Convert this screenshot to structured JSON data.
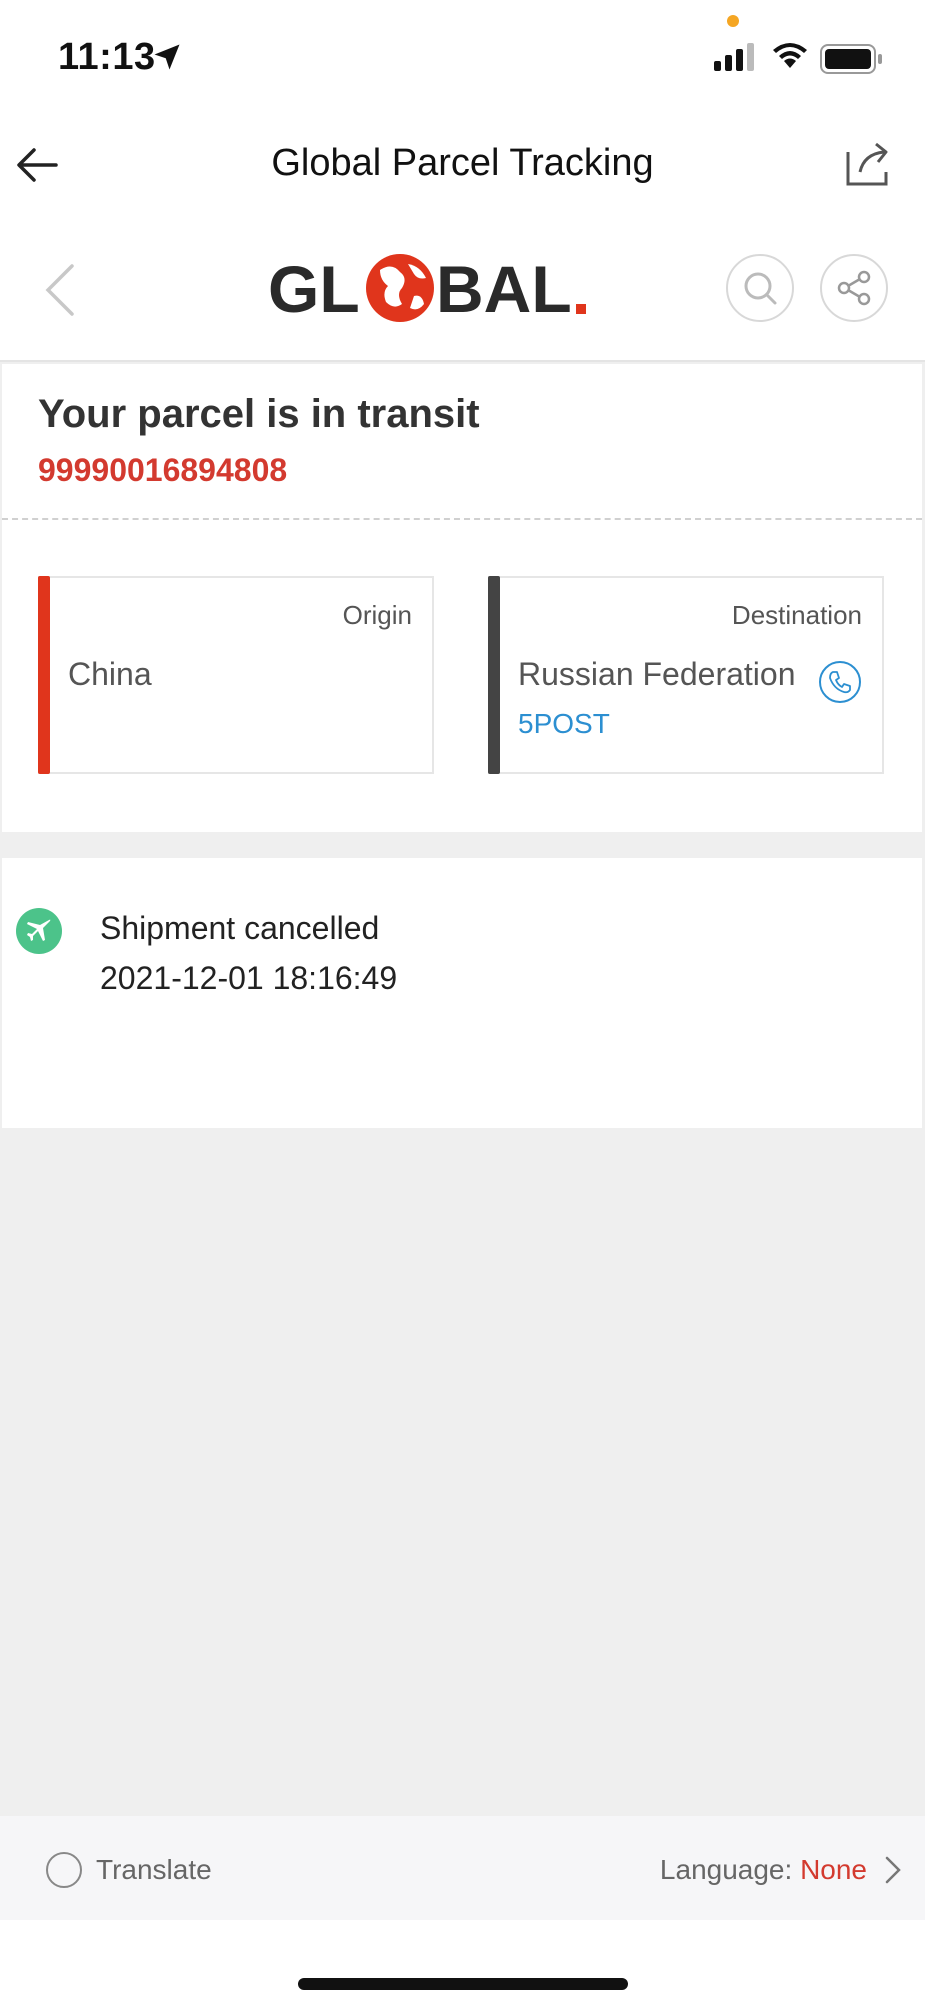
{
  "status_bar": {
    "time": "11:13"
  },
  "nav": {
    "title": "Global Parcel Tracking"
  },
  "brand": {
    "logo_text": "GLOBAL",
    "accent_color": "#e0351c"
  },
  "summary": {
    "headline": "Your parcel is in transit",
    "tracking_number": "99990016894808"
  },
  "origin": {
    "label": "Origin",
    "country": "China"
  },
  "destination": {
    "label": "Destination",
    "country": "Russian Federation",
    "carrier": "5POST"
  },
  "events": [
    {
      "status": "Shipment cancelled",
      "timestamp": "2021-12-01 18:16:49",
      "icon": "plane-icon"
    }
  ],
  "footer": {
    "translate_label": "Translate",
    "language_label": "Language:",
    "language_value": "None"
  },
  "colors": {
    "tracking_red": "#d33a2f",
    "carrier_blue": "#2c8fd1",
    "event_green": "#4cc38a"
  }
}
